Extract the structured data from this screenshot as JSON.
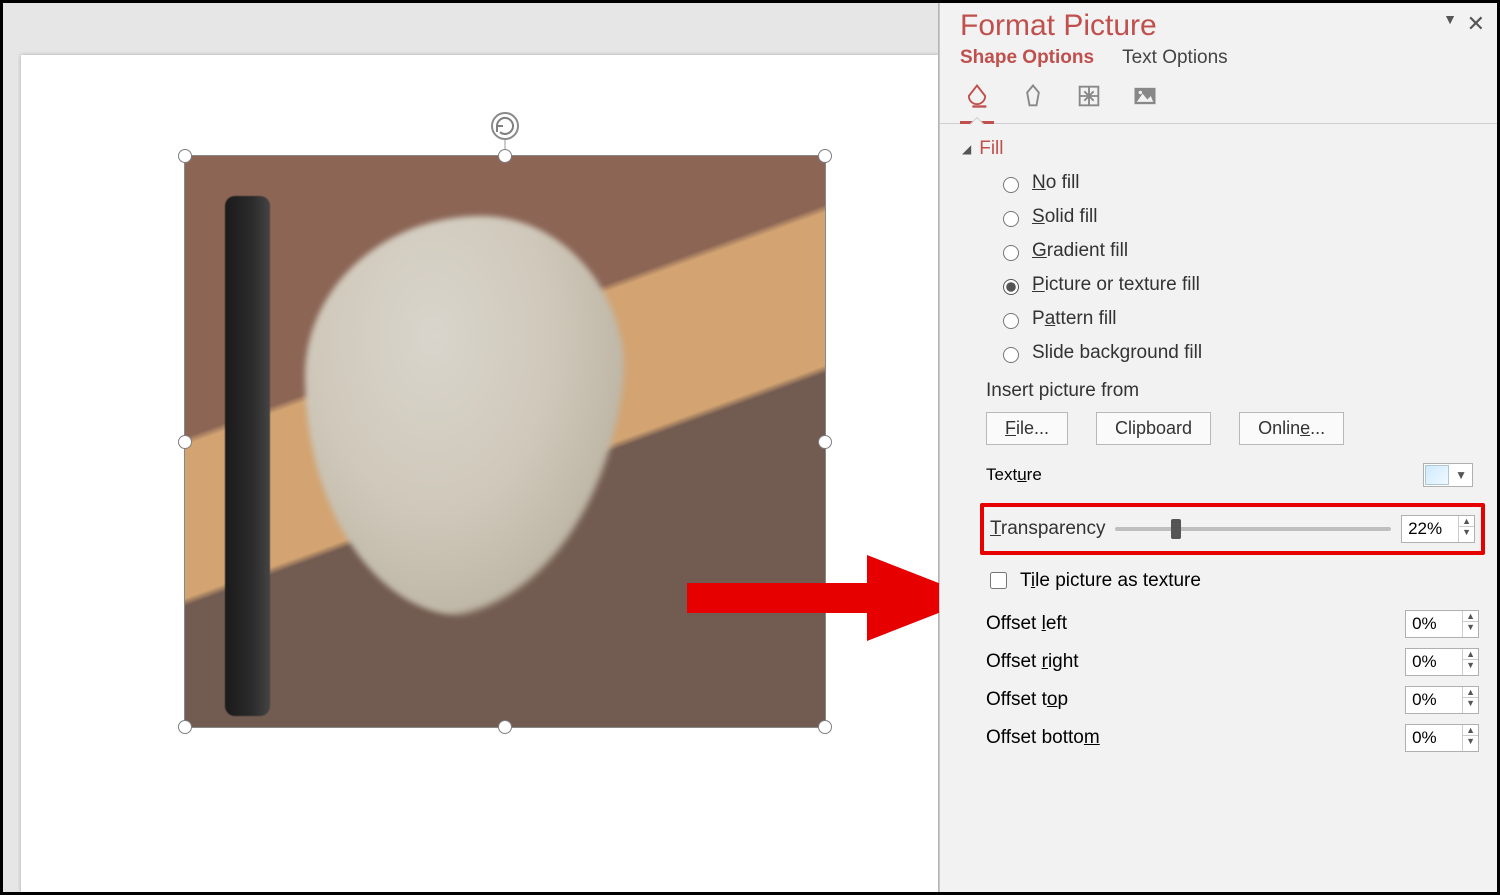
{
  "panel": {
    "title": "Format Picture",
    "tabs": {
      "shape": "Shape Options",
      "text": "Text Options"
    },
    "icon_names": [
      "fill-line-icon",
      "effects-icon",
      "size-properties-icon",
      "picture-icon"
    ],
    "section_fill": "Fill",
    "fill_options": {
      "none": "No fill",
      "solid": "Solid fill",
      "gradient": "Gradient fill",
      "picture": "Picture or texture fill",
      "pattern": "Pattern fill",
      "background": "Slide background fill",
      "selected": "picture"
    },
    "insert_label": "Insert picture from",
    "buttons": {
      "file": "File...",
      "clipboard": "Clipboard",
      "online": "Online..."
    },
    "texture_label": "Texture",
    "transparency": {
      "label": "Transparency",
      "value": "22%",
      "percent": 22
    },
    "tile_checkbox": "Tile picture as texture",
    "offsets": {
      "left": {
        "label": "Offset left",
        "value": "0%"
      },
      "right": {
        "label": "Offset right",
        "value": "0%"
      },
      "top": {
        "label": "Offset top",
        "value": "0%"
      },
      "bottom": {
        "label": "Offset bottom",
        "value": "0%"
      }
    }
  }
}
